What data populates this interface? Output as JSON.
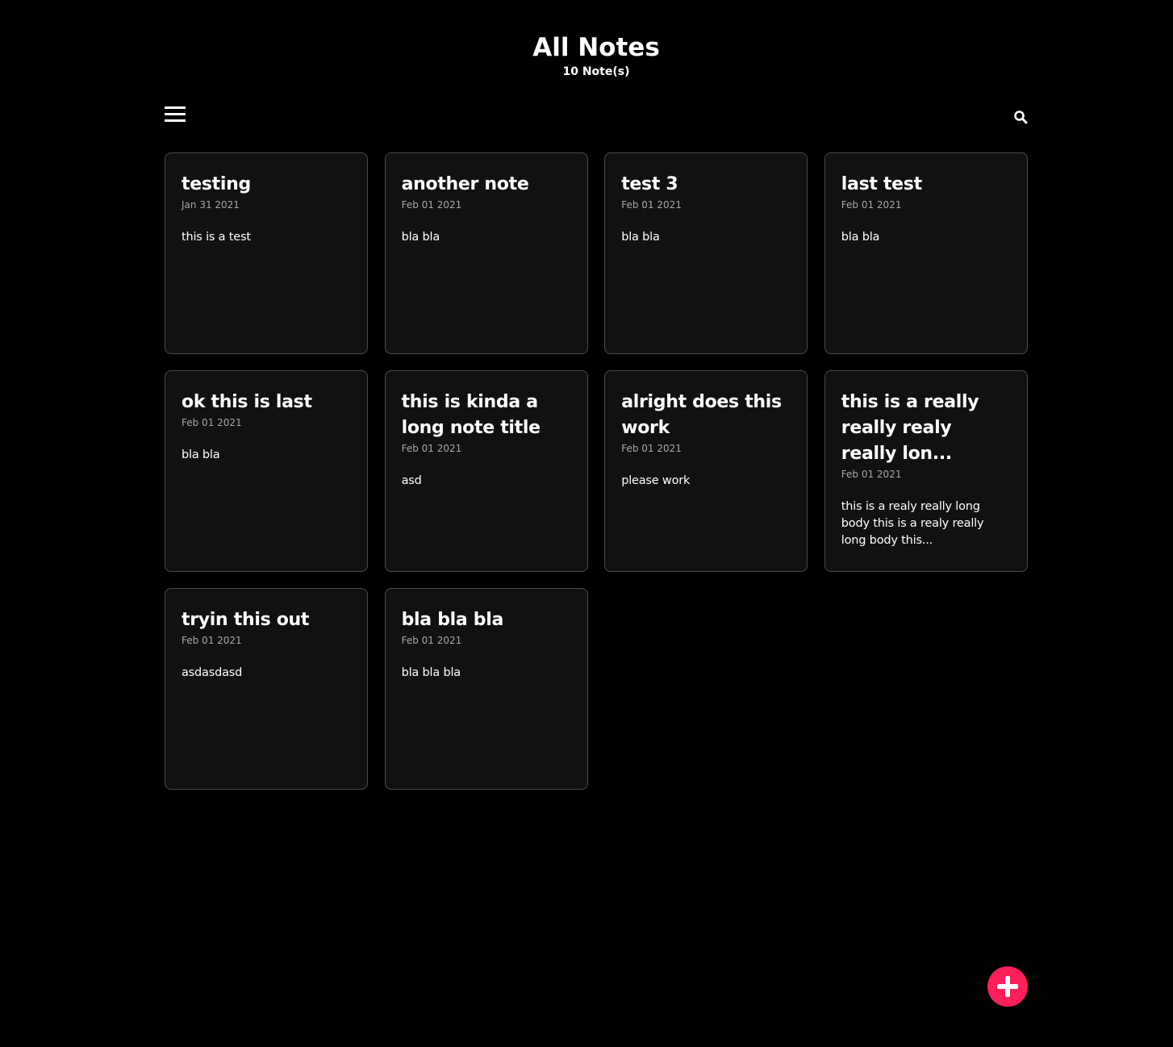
{
  "header": {
    "title": "All Notes",
    "count": "10 Note(s)"
  },
  "toolbar": {
    "menu_icon": "hamburger-menu-icon",
    "search_icon": "search-icon"
  },
  "notes": [
    {
      "title": "testing",
      "date": "Jan 31 2021",
      "body": "this is a test"
    },
    {
      "title": "another note",
      "date": "Feb 01 2021",
      "body": "bla bla"
    },
    {
      "title": "test 3",
      "date": "Feb 01 2021",
      "body": "bla bla"
    },
    {
      "title": "last test",
      "date": "Feb 01 2021",
      "body": "bla bla"
    },
    {
      "title": "ok this is last",
      "date": "Feb 01 2021",
      "body": "bla bla"
    },
    {
      "title": "this is kinda a long note title",
      "date": "Feb 01 2021",
      "body": "asd"
    },
    {
      "title": "alright does this work",
      "date": "Feb 01 2021",
      "body": "please work"
    },
    {
      "title": "this is a really really realy really lon...",
      "date": "Feb 01 2021",
      "body": "this is a realy really long body this is a realy really long body this..."
    },
    {
      "title": "tryin this out",
      "date": "Feb 01 2021",
      "body": "asdasdasd"
    },
    {
      "title": "bla bla bla",
      "date": "Feb 01 2021",
      "body": "bla bla bla"
    }
  ],
  "fab": {
    "icon": "plus-icon",
    "color": "#ff1f5a"
  },
  "colors": {
    "background": "#000000",
    "card_background": "#111111",
    "card_border": "#4a4a4a",
    "accent": "#ff1f5a"
  }
}
